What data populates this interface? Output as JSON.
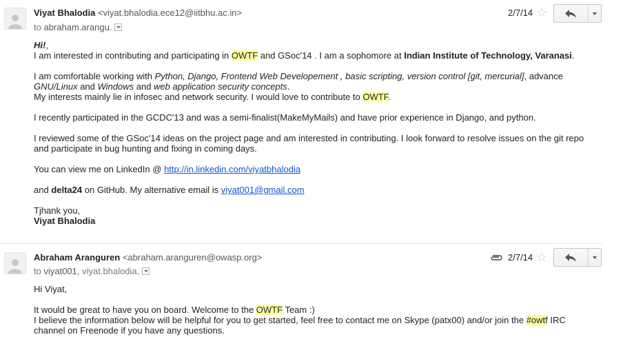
{
  "messages": [
    {
      "sender_name": "Viyat Bhalodia",
      "sender_email": "<viyat.bhalodia.ece12@iitbhu.ac.in>",
      "to_prefix": "to",
      "to_names": "abraham.arangu.",
      "date": "2/7/14",
      "has_attachment": false,
      "lines": {
        "greeting": "Hi!",
        "greeting_punct": ",",
        "p1a": "I am interested in contributing and participating in ",
        "owtf": "OWTF",
        "p1b": " and GSoc'14 . I am a sophomore at ",
        "p1c": "Indian Institute of Technology, Varanasi",
        "p1d": ".",
        "p2a": "I am comfortable working with ",
        "p2b": "Python, Django, Frontend Web Developement , basic scripting, version control [git, mercurial]",
        "p2c": ", advance",
        "p2d": "GNU/Linux",
        "p2e": " and ",
        "p2f": "Windows",
        "p2g": " and ",
        "p2h": "web application security concepts",
        "p2i": ".",
        "p3a": "My interests mainly lie in infosec and network security. I would love to contribute to ",
        "p3b": "OWTF",
        "p3c": ".",
        "p4": "I recently participated in the GCDC'13 and was a semi-finalist(MakeMyMails) and have prior experience in Django, and python.",
        "p5": "I reviewed some of the GSoc'14 ideas on the project page and am interested in contributing. I look forward to resolve issues on the git repo and participate in bug hunting and fixing in coming days.",
        "p6a": "You can view me on LinkedIn @ ",
        "p6link": "http://in.linkedin.com/viyatbhalodia",
        "p7a": "and ",
        "p7b": "delta24",
        "p7c": " on GitHub. My alternative email is ",
        "p7link": "viyat001@gmail.com",
        "sign1": "Tjhank you,",
        "sign2": "Viyat Bhalodia"
      }
    },
    {
      "sender_name": "Abraham Aranguren",
      "sender_email": "<abraham.aranguren@owasp.org>",
      "to_prefix": "to",
      "to_names_a": "viyat001",
      "to_names_b": ", viyat.bhalodia.",
      "date": "2/7/14",
      "has_attachment": true,
      "lines": {
        "greeting": "Hi Viyat,",
        "p1a": "It would be great to have you on board. Welcome to the ",
        "owtf": "OWTF",
        "p1b": " Team :)",
        "p2a": "I believe the information below will be helpful for you to get started, feel free to contact me on Skype (patx00) and/or join the ",
        "p2b": "#owtf",
        "p2c": " IRC",
        "p2d": "channel on Freenode if you have any questions."
      }
    }
  ],
  "icons": {
    "star": "star-icon",
    "reply": "reply-icon",
    "more": "chevron-down-icon",
    "attachment": "paperclip-icon",
    "avatar": "default-avatar-icon"
  },
  "colors": {
    "highlight": "#ffffa0",
    "link": "#1155cc"
  }
}
